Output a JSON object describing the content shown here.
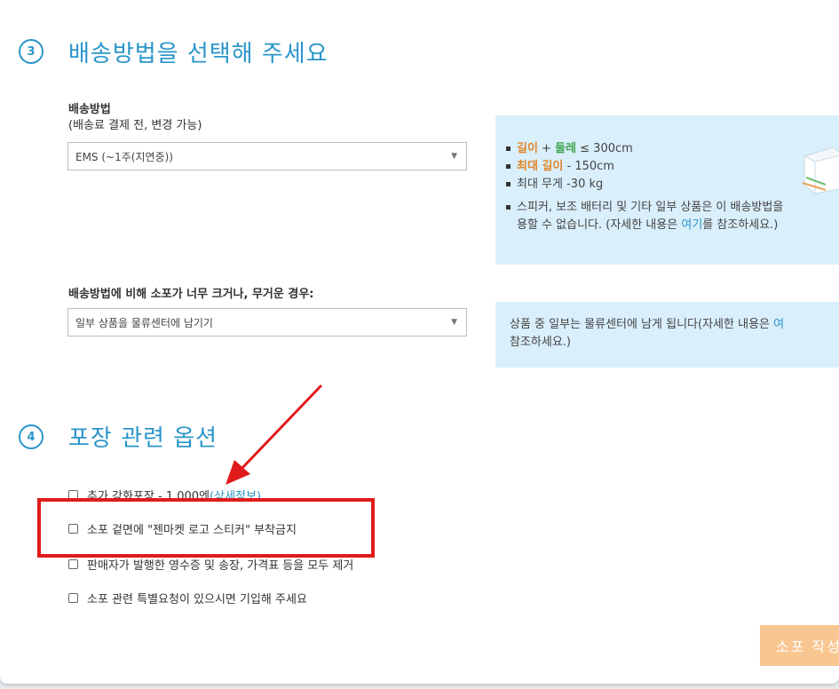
{
  "section3": {
    "number": "3",
    "title": "배송방법을 선택해 주세요",
    "method_label_line1": "배송방법",
    "method_label_line2": "(배송료 결제 전, 변경 가능)",
    "method_select_value": "EMS (~1주(지연중))",
    "info": {
      "length_label": "길이",
      "plus": " + ",
      "girth_label": "둘레",
      "limit1_rest": " ≤ 300cm",
      "max_length_label": "최대 길이",
      "limit2_rest": " - 150cm",
      "weight_limit": "최대 무게 -30 kg",
      "note_line1": "스피커, 보조 배터리 및 기타 일부 상품은 이 배송방법을",
      "note_line2_pre": "용할 수 없습니다. (자세한 내용은 ",
      "note_link": "여기",
      "note_line2_post": "를 참조하세요.)"
    },
    "oversize_label": "배송방법에 비해 소포가 너무 크거나, 무거운 경우:",
    "oversize_select_value": "일부 상품을 물류센터에 남기기",
    "oversize_info_line1_pre": "상품 중 일부는 물류센터에 남게 됩니다(자세한 내용은 ",
    "oversize_info_link": "여",
    "oversize_info_line2": "참조하세요.)"
  },
  "section4": {
    "number": "4",
    "title": "포장 관련 옵션",
    "options": [
      {
        "text": "추가 강화포장 - 1,000엔",
        "link": "(상세정보)"
      },
      {
        "text": "소포 겉면에 \"젠마켓 로고 스티커\" 부착금지"
      },
      {
        "text": "판매자가 발행한 영수증 및 송장, 가격표 등을 모두 제거"
      },
      {
        "text": "소포 관련 특별요청이 있으시면 기입해 주세요"
      }
    ]
  },
  "submit_label": "소포 작성",
  "colors": {
    "accent": "#2a95c9",
    "info_bg": "#d9effb",
    "highlight_orange": "#e0862a",
    "highlight_green": "#3fa34d",
    "annotation_red": "#e01b1b",
    "submit_bg": "#f8c690"
  },
  "annotation": {
    "arrow": "red-arrow",
    "box": "red-highlight-box"
  }
}
